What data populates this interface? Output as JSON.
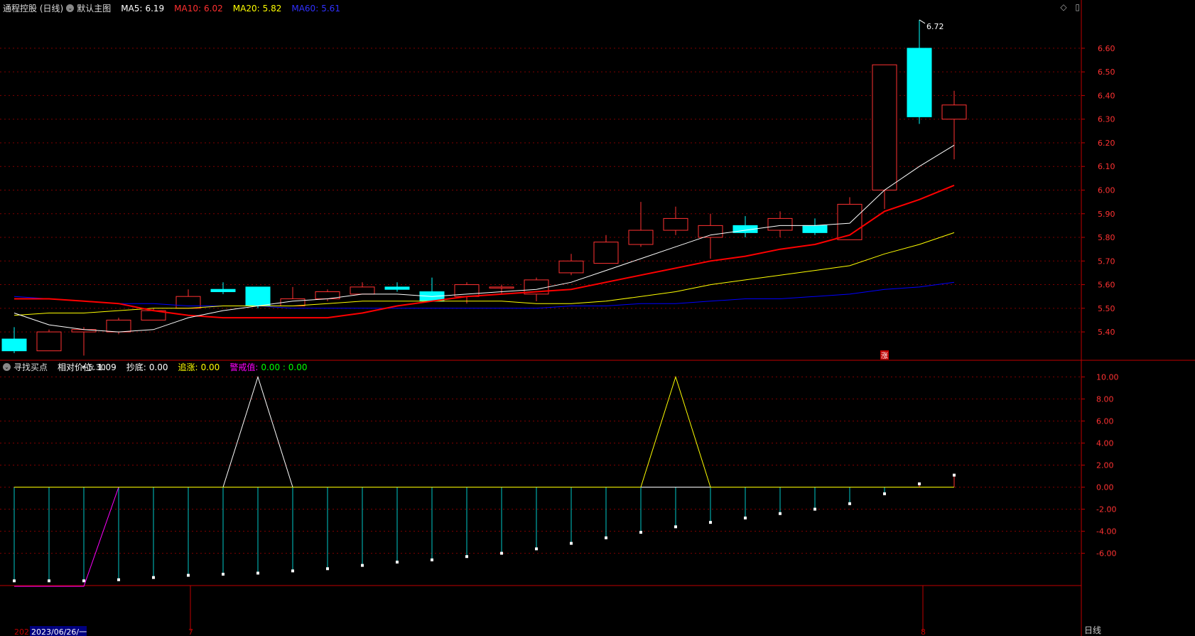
{
  "main_header": {
    "name": "通程控股 (日线)",
    "template": "默认主图",
    "ma5_label": "MA5:",
    "ma5": "6.19",
    "ma10_label": "MA10:",
    "ma10": "6.02",
    "ma20_label": "MA20:",
    "ma20": "5.82",
    "ma60_label": "MA60:",
    "ma60": "5.61"
  },
  "sub_header": {
    "name": "寻找买点",
    "rel_label": "相对价位:",
    "rel": "1.09",
    "dip_label": "抄底:",
    "dip": "0.00",
    "chase_label": "追涨:",
    "chase": "0.00",
    "alert_label": "警戒值:",
    "alert": "0.00 : 0.00"
  },
  "annotations": {
    "high": "6.72",
    "low": "←5.30",
    "rise_mark": "涨"
  },
  "bottom_axis": {
    "year_clip": "2023",
    "date": "2023/06/26/一",
    "month_7": "7",
    "month_8": "8",
    "period": "日线"
  },
  "colors": {
    "up": "#ff3232",
    "down": "#00ffff",
    "ma5": "#ffffff",
    "ma10": "#ff0000",
    "ma20": "#ffff00",
    "ma60": "#0000ff",
    "axis": "#c00000",
    "grid": "#800000",
    "indicator_base": "#00ff00",
    "indicator_bars": "#00c8c8",
    "peak_white": "#ffffff",
    "peak_yellow": "#ffff00",
    "magenta": "#ff00ff"
  },
  "chart_data": [
    {
      "type": "candlestick",
      "ylim": [
        5.28,
        6.75
      ],
      "yticks": [
        "5.40",
        "5.50",
        "5.60",
        "5.70",
        "5.80",
        "5.90",
        "6.00",
        "6.10",
        "6.20",
        "6.30",
        "6.40",
        "6.50",
        "6.60"
      ],
      "candles": [
        {
          "o": 5.37,
          "h": 5.42,
          "l": 5.31,
          "c": 5.32
        },
        {
          "o": 5.32,
          "h": 5.41,
          "l": 5.32,
          "c": 5.4
        },
        {
          "o": 5.4,
          "h": 5.42,
          "l": 5.3,
          "c": 5.41
        },
        {
          "o": 5.4,
          "h": 5.46,
          "l": 5.39,
          "c": 5.45
        },
        {
          "o": 5.45,
          "h": 5.5,
          "l": 5.45,
          "c": 5.49
        },
        {
          "o": 5.5,
          "h": 5.58,
          "l": 5.5,
          "c": 5.55
        },
        {
          "o": 5.58,
          "h": 5.61,
          "l": 5.56,
          "c": 5.57
        },
        {
          "o": 5.59,
          "h": 5.59,
          "l": 5.5,
          "c": 5.51
        },
        {
          "o": 5.51,
          "h": 5.59,
          "l": 5.51,
          "c": 5.54
        },
        {
          "o": 5.54,
          "h": 5.58,
          "l": 5.53,
          "c": 5.57
        },
        {
          "o": 5.56,
          "h": 5.61,
          "l": 5.56,
          "c": 5.59
        },
        {
          "o": 5.59,
          "h": 5.61,
          "l": 5.57,
          "c": 5.58
        },
        {
          "o": 5.57,
          "h": 5.63,
          "l": 5.53,
          "c": 5.53
        },
        {
          "o": 5.55,
          "h": 5.61,
          "l": 5.52,
          "c": 5.6
        },
        {
          "o": 5.59,
          "h": 5.6,
          "l": 5.56,
          "c": 5.59
        },
        {
          "o": 5.56,
          "h": 5.63,
          "l": 5.53,
          "c": 5.62
        },
        {
          "o": 5.65,
          "h": 5.73,
          "l": 5.64,
          "c": 5.7
        },
        {
          "o": 5.69,
          "h": 5.81,
          "l": 5.69,
          "c": 5.78
        },
        {
          "o": 5.77,
          "h": 5.95,
          "l": 5.76,
          "c": 5.83
        },
        {
          "o": 5.83,
          "h": 5.93,
          "l": 5.81,
          "c": 5.88
        },
        {
          "o": 5.8,
          "h": 5.9,
          "l": 5.71,
          "c": 5.85
        },
        {
          "o": 5.85,
          "h": 5.89,
          "l": 5.8,
          "c": 5.82
        },
        {
          "o": 5.83,
          "h": 5.91,
          "l": 5.8,
          "c": 5.88
        },
        {
          "o": 5.85,
          "h": 5.88,
          "l": 5.81,
          "c": 5.82
        },
        {
          "o": 5.79,
          "h": 5.97,
          "l": 5.79,
          "c": 5.94
        },
        {
          "o": 6.0,
          "h": 6.53,
          "l": 5.92,
          "c": 6.53
        },
        {
          "o": 6.6,
          "h": 6.72,
          "l": 6.28,
          "c": 6.31
        },
        {
          "o": 6.3,
          "h": 6.42,
          "l": 6.13,
          "c": 6.36
        }
      ],
      "ma5": [
        5.48,
        5.43,
        5.41,
        5.4,
        5.41,
        5.46,
        5.49,
        5.51,
        5.53,
        5.54,
        5.56,
        5.56,
        5.55,
        5.56,
        5.57,
        5.58,
        5.61,
        5.66,
        5.71,
        5.76,
        5.81,
        5.83,
        5.85,
        5.85,
        5.86,
        6.0,
        6.1,
        6.19
      ],
      "ma10": [
        5.54,
        5.54,
        5.53,
        5.52,
        5.49,
        5.47,
        5.46,
        5.46,
        5.46,
        5.46,
        5.48,
        5.51,
        5.53,
        5.55,
        5.56,
        5.57,
        5.58,
        5.61,
        5.64,
        5.67,
        5.7,
        5.72,
        5.75,
        5.77,
        5.81,
        5.91,
        5.96,
        6.02
      ],
      "ma20": [
        5.47,
        5.48,
        5.48,
        5.49,
        5.5,
        5.5,
        5.51,
        5.51,
        5.51,
        5.52,
        5.53,
        5.53,
        5.53,
        5.53,
        5.53,
        5.52,
        5.52,
        5.53,
        5.55,
        5.57,
        5.6,
        5.62,
        5.64,
        5.66,
        5.68,
        5.73,
        5.77,
        5.82
      ],
      "ma60": [
        5.55,
        5.54,
        5.53,
        5.52,
        5.52,
        5.51,
        5.51,
        5.51,
        5.5,
        5.5,
        5.5,
        5.5,
        5.5,
        5.5,
        5.5,
        5.5,
        5.51,
        5.51,
        5.52,
        5.52,
        5.53,
        5.54,
        5.54,
        5.55,
        5.56,
        5.58,
        5.59,
        5.61
      ]
    },
    {
      "type": "indicator",
      "ylim": [
        -8.8,
        10.8
      ],
      "yticks": [
        "10.00",
        "8.00",
        "6.00",
        "4.00",
        "2.00",
        "0.00",
        "-2.00",
        "-4.00",
        "-6.00"
      ],
      "relative_price": [
        -8.5,
        -8.5,
        -8.5,
        -8.4,
        -8.2,
        -8.0,
        -7.9,
        -7.8,
        -7.6,
        -7.4,
        -7.1,
        -6.8,
        -6.6,
        -6.3,
        -6.0,
        -5.6,
        -5.1,
        -4.6,
        -4.1,
        -3.6,
        -3.2,
        -2.8,
        -2.4,
        -2.0,
        -1.5,
        -0.6,
        0.3,
        1.09
      ],
      "dip": [
        0,
        0,
        0,
        0,
        0,
        0,
        0,
        10,
        0,
        0,
        0,
        0,
        0,
        0,
        0,
        0,
        0,
        0,
        0,
        0,
        0,
        0,
        0,
        0,
        0,
        0,
        0,
        0
      ],
      "chase": [
        0,
        0,
        0,
        0,
        0,
        0,
        0,
        0,
        0,
        0,
        0,
        0,
        0,
        0,
        0,
        0,
        0,
        0,
        0,
        10,
        0,
        0,
        0,
        0,
        0,
        0,
        0,
        0
      ],
      "alert": [
        -9,
        -9,
        -9,
        0,
        0,
        0,
        0,
        0,
        0,
        0,
        0,
        0,
        0,
        0,
        0,
        0,
        0,
        0,
        0,
        0,
        0,
        0,
        0,
        0,
        0,
        0,
        0,
        0
      ]
    }
  ]
}
